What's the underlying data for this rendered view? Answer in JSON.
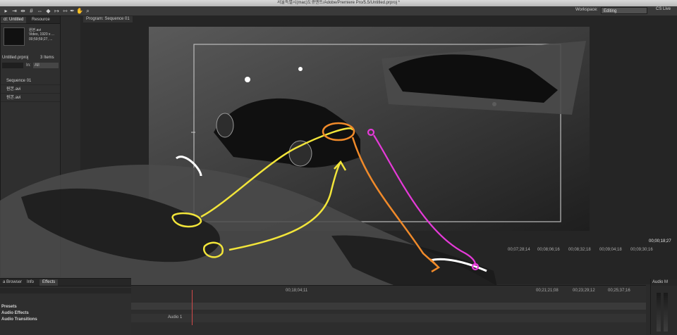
{
  "window": {
    "title": "서울특별시(mac)도큐멘트/Adobe/Premiere Pro/5.5/Untitled.prproj *"
  },
  "toolbar": {
    "workspace_label": "Workspace:",
    "workspace_value": "Editing",
    "cslive_label": "CS Live"
  },
  "project": {
    "tabs": [
      {
        "label": "ct: Untitled"
      },
      {
        "label": "Resource"
      }
    ],
    "clip_meta": [
      "원본.avi",
      "Video, 1920 x ...",
      "00;59;59;27, ..."
    ],
    "project_file": "Untitled.prproj",
    "item_count": "3 Items",
    "in_label": "In:",
    "in_value": "All",
    "items": [
      {
        "label": "Sequence 01"
      },
      {
        "label": "원본.avi"
      },
      {
        "label": "원본.avi"
      }
    ]
  },
  "program": {
    "tab_label": "Program: Sequence 01",
    "current_timecode": "00;00;18;27"
  },
  "program_ruler": [
    "00;07;28;14",
    "00;08;06;16",
    "00;08;32;18",
    "00;09;04;18",
    "00;09;30;16"
  ],
  "effects": {
    "tabs": [
      {
        "label": "a Browser"
      },
      {
        "label": "Info"
      },
      {
        "label": "Effects"
      }
    ],
    "rows": [
      {
        "label": "Presets"
      },
      {
        "label": "Audio Effects"
      },
      {
        "label": "Audio Transitions"
      }
    ]
  },
  "timeline": {
    "ruler": [
      "00;21;21;08",
      "00;23;29;12",
      "00;25;37;16"
    ],
    "sequence_marker": "00;18;04;11",
    "track_label": "Audio 1"
  },
  "audio_meter": {
    "title": "Audio M"
  },
  "annotation_colors": {
    "yellow": "#f2e53a",
    "orange": "#f08a2a",
    "magenta": "#e53ad8"
  }
}
